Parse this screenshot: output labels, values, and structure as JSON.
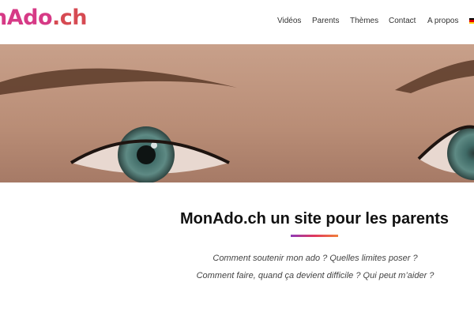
{
  "header": {
    "logo_part1": "nAdo",
    "logo_part2": ".ch",
    "nav": [
      {
        "label": "Vidéos"
      },
      {
        "label": "Parents"
      },
      {
        "label": "Thèmes"
      },
      {
        "label": "Contact"
      },
      {
        "label": "A propos"
      }
    ]
  },
  "hero": {
    "image": "close-up-eyes-photo"
  },
  "main": {
    "title": "MonAdo.ch un site pour les parents",
    "subtitle_line1": "Comment soutenir mon ado ? Quelles limites poser ?",
    "subtitle_line2": "Comment faire, quand ça devient difficile ? Qui peut m’aider ?"
  },
  "colors": {
    "logo_pink": "#d63a86",
    "logo_red": "#d64a52",
    "underline_start": "#8e3bb8",
    "underline_end": "#f0803a"
  }
}
